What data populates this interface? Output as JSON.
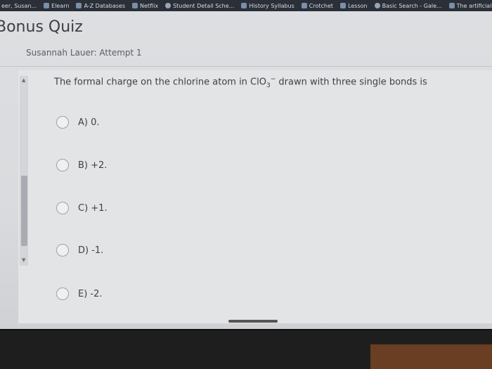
{
  "bookmarks": [
    {
      "label": "eer, Susan..."
    },
    {
      "label": "Elearn"
    },
    {
      "label": "A-Z Databases"
    },
    {
      "label": "Netflix"
    },
    {
      "label": "Student Detail Sche..."
    },
    {
      "label": "History Syllabus"
    },
    {
      "label": "Crotchet"
    },
    {
      "label": "Lesson"
    },
    {
      "label": "Basic Search - Gale..."
    },
    {
      "label": "The artificial..."
    }
  ],
  "quiz": {
    "title": "Bonus Quiz",
    "attempt": "Susannah Lauer: Attempt 1"
  },
  "question": {
    "prefix": "The formal charge on the chlorine atom in ClO",
    "subscript": "3",
    "superscript": "−",
    "suffix": " drawn with three single bonds is"
  },
  "options": [
    {
      "label": "A)  0."
    },
    {
      "label": "B)  +2."
    },
    {
      "label": "C)  +1."
    },
    {
      "label": "D)  -1."
    },
    {
      "label": "E)  -2."
    }
  ],
  "scroll_arrows": {
    "up": "▲",
    "down": "▼"
  }
}
